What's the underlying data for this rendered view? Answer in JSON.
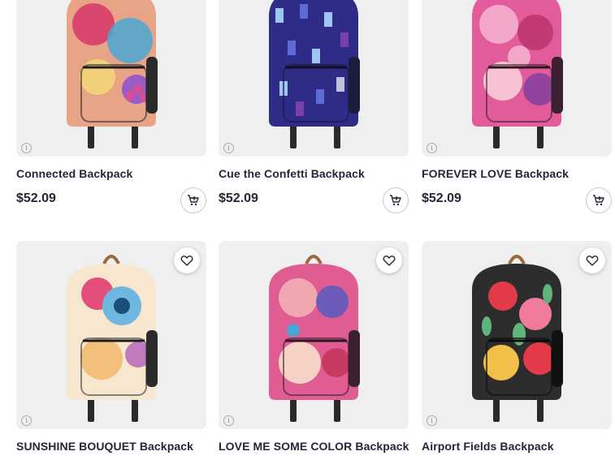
{
  "products": [
    {
      "title": "Connected Backpack",
      "price": "$52.09",
      "colors": [
        "#e9a27d",
        "#d9466e",
        "#4aa7d3",
        "#9a5cc6",
        "#f2d07b"
      ],
      "info_icon": "info-icon",
      "cart_icon": "add-to-cart-icon"
    },
    {
      "title": "Cue the Confetti Backpack",
      "price": "$52.09",
      "colors": [
        "#2e2c86",
        "#5c6bd6",
        "#9ec6f2",
        "#7b3fa8",
        "#1c2a5f"
      ],
      "info_icon": "info-icon",
      "cart_icon": "add-to-cart-icon"
    },
    {
      "title": "FOREVER LOVE Backpack",
      "price": "$52.09",
      "colors": [
        "#e25b9a",
        "#c23a74",
        "#f3a8c9",
        "#7c3f9e",
        "#f6c2d4"
      ],
      "info_icon": "info-icon",
      "cart_icon": "add-to-cart-icon"
    },
    {
      "title": "SUNSHINE BOUQUET Backpack",
      "price": "",
      "colors": [
        "#f3c07c",
        "#e34e7a",
        "#6fb7e0",
        "#f7e7cf",
        "#b45fb9"
      ],
      "info_icon": "info-icon",
      "heart_icon": "heart-icon"
    },
    {
      "title": "LOVE ME SOME COLOR Backpack",
      "price": "",
      "colors": [
        "#e05d93",
        "#f1a7b0",
        "#6d5bb9",
        "#f5d1c6",
        "#c93a63"
      ],
      "info_icon": "info-icon",
      "heart_icon": "heart-icon"
    },
    {
      "title": "Airport Fields Backpack",
      "price": "",
      "colors": [
        "#2d2d2d",
        "#e33b49",
        "#f2c048",
        "#5fb47e",
        "#f07a9a"
      ],
      "info_icon": "info-icon",
      "heart_icon": "heart-icon"
    }
  ]
}
